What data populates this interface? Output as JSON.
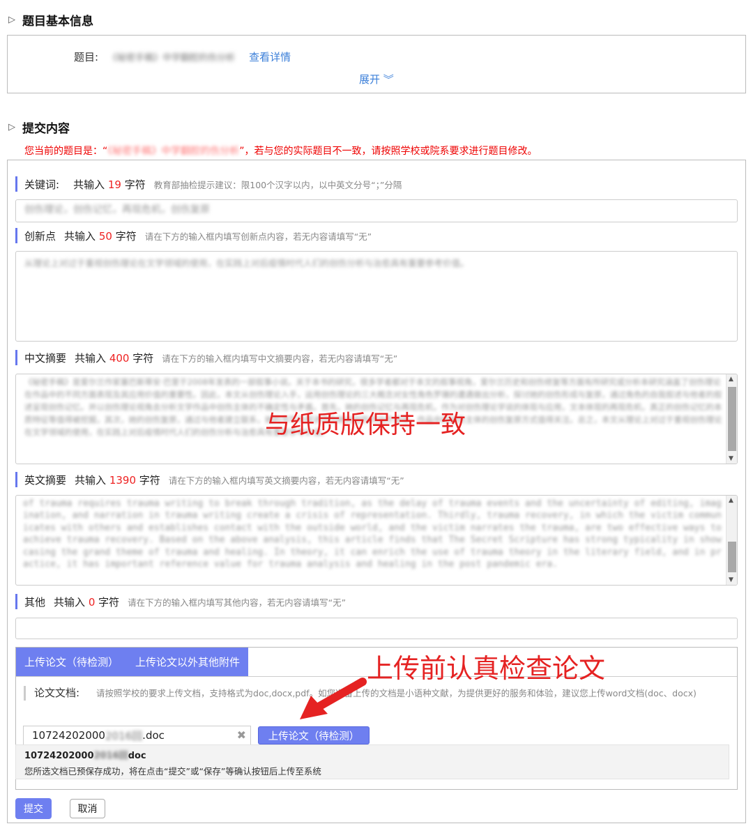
{
  "section_basic": {
    "title": "题目基本信息",
    "topic_label": "题目:",
    "topic_value": "《秘密手稿》中学翻腔的伤分析",
    "details_link": "查看详情",
    "expand_label": "展开 ︾"
  },
  "section_submit": {
    "title": "提交内容",
    "warning_prefix": "您当前的题目是：“",
    "warning_topic": "《秘密手稿》中学翻腔的伤分析",
    "warning_suffix": "”，若与您的实际题目不一致，请按照学校或院系要求进行题目修改。"
  },
  "keywords": {
    "label": "关键词:",
    "count_prefix": "共输入",
    "count": "19",
    "count_suffix": "字符",
    "hint": "教育部抽检提示建议：限100个汉字以内，以中英文分号“；”分隔",
    "value": "创伤理论，创伤记忆，再现危机，创伤复原"
  },
  "innovation": {
    "label": "创新点",
    "count_prefix": "共输入",
    "count": "50",
    "count_suffix": "字符",
    "hint": "请在下方的输入框内填写创新点内容，若无内容请填写“无”",
    "value": "从理论上对过于重视创伤理论在文学领域的使用，在实践上对后疫情时代人们的创伤分析与治愈具有重要参考价值。"
  },
  "cn_abstract": {
    "label": "中文摘要",
    "count_prefix": "共输入",
    "count": "400",
    "count_suffix": "字符",
    "hint": "请在下方的输入框内填写中文摘要内容，若无内容请填写“无”",
    "value": "《秘密手稿》是爱尔兰作家塞巴斯蒂安·巴里于2008年发表的一部叙事小说。关于本书的研究，很多学者都对于本文的叙事视角，爱尔兰历史和创伤修复等方面有所研究或分析本研究涵盖了创伤理论在作品中的不同方面表现及其应用价值的重要性。因此，本文从创伤理论入手，运用创伤理论的三大概念对女性角色罗珊的遭遇做出分析，探讨她的创伤形成与复原，通过角色的自我叙述与他者的叙述呈现创伤记忆。并以创伤理论视角去分析文学作品中创伤主体的不确定性与矛盾。首先，她的创伤记忆与再现危机，作为对创伤理论学说的体现与应用，文本体现的再现危机，真正的创伤记忆的本质特征等值得被挖掘，其次，她的创伤复原，通过与他者建立联系，她的书写与叙述作为她对创伤的治疗途径，作品中的创伤主体的创伤复原方式值得关注。总之，本文从理论上对过于重视创伤理论在文学领域的使用，在实践上对后疫情时代人们的创伤分析与治愈具有重要参考价值。"
  },
  "en_abstract": {
    "label": "英文摘要",
    "count_prefix": "共输入",
    "count": "1390",
    "count_suffix": "字符",
    "hint": "请在下方的输入框内填写英文摘要内容，若无内容请填写“无”",
    "value": "of trauma requires trauma writing to break through tradition, as the delay of trauma events and the uncertainty of editing, imagination, and narration in trauma writing create a crisis of representation. Thirdly, trauma recovery, in which the victim communicates with others and establishes contact with the outside world, and the victim narrates the trauma, are two effective ways to achieve trauma recovery. Based on the above analysis, this article finds that The Secret Scripture has strong typicality in showcasing the grand theme of trauma and healing. In theory, it can enrich the use of trauma theory in the literary field, and in practice, it has important reference value for trauma analysis and healing in the post pandemic era."
  },
  "other": {
    "label": "其他",
    "count_prefix": "共输入",
    "count": "0",
    "count_suffix": "字符",
    "hint": "请在下方的输入框内填写其他内容，若无内容请填写“无”",
    "value": ""
  },
  "upload": {
    "tab1": "上传论文（待检测）",
    "tab2": "上传论文以外其他附件",
    "doc_label": "论文文档:",
    "doc_hint": "请按照学校的要求上传文档，支持格式为doc,docx,pdf。如您准备上传的文档是小语种文献，为提供更好的服务和体验，建议您上传word文档(doc、docx)",
    "file_prefix": "10724202000",
    "file_blur": "2016回",
    "file_ext": ".doc",
    "clear_icon": "✖",
    "upload_button": "上传论文（待检测）",
    "uploaded_name_prefix": "10724202000",
    "uploaded_name_blur": "2016回",
    "uploaded_name_ext": "doc",
    "uploaded_message": "您所选文档已预保存成功，将在点击“提交”或“保存”等确认按钮后上传至系统"
  },
  "annotations": {
    "note1": "与纸质版保持一致",
    "note2": "上传前认真检查论文"
  },
  "actions": {
    "submit": "提交",
    "cancel": "取消"
  },
  "colors": {
    "accent": "#6e7ff0",
    "warning": "#e00000",
    "link": "#3b7fd9"
  }
}
